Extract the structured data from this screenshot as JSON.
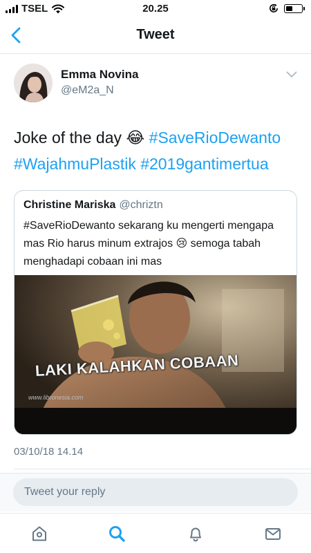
{
  "status_bar": {
    "carrier": "TSEL",
    "time": "20.25"
  },
  "navbar": {
    "title": "Tweet"
  },
  "tweet": {
    "author_name": "Emma Novina",
    "author_handle": "@eM2a_N",
    "text_prefix": "Joke of the day 😂",
    "hashtags": [
      "#SaveRioDewanto",
      "#WajahmuPlastik",
      "#2019gantimertua"
    ],
    "timestamp": "03/10/18 14.14"
  },
  "quoted_tweet": {
    "author_name": "Christine Mariska",
    "author_handle": "@chriztn",
    "text": "#SaveRioDewanto sekarang ku mengerti mengapa mas Rio harus minum extrajos 😢 semoga tabah menghadapi cobaan ini mas",
    "media_caption": "LAKI KALAHKAN COBAAN",
    "media_watermark": "www.libronesia.com"
  },
  "reply": {
    "placeholder": "Tweet your reply"
  },
  "tabbar": {
    "items": [
      "home-icon",
      "search-icon",
      "notifications-icon",
      "messages-icon"
    ],
    "active": "search-icon"
  },
  "colors": {
    "accent": "#1da1f2",
    "secondary_text": "#657786"
  }
}
